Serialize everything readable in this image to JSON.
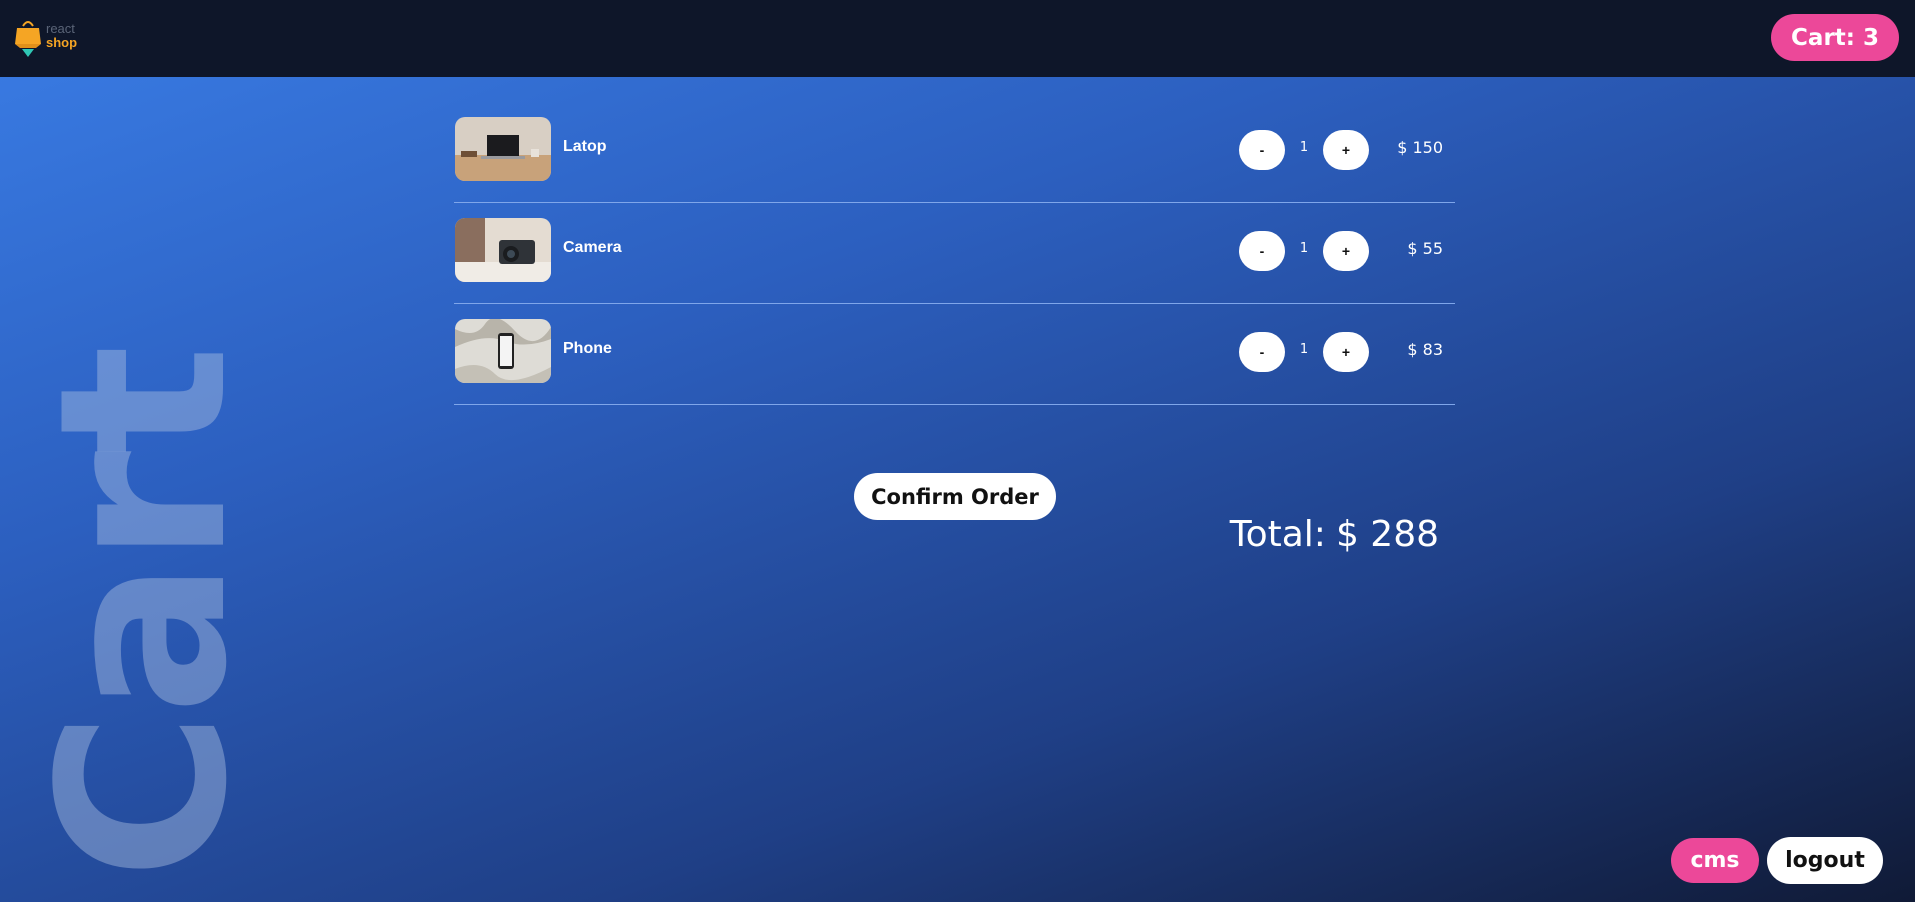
{
  "header": {
    "logo_text_1": "react",
    "logo_text_2": "shop",
    "cart_label": "Cart:",
    "cart_count": "3"
  },
  "page": {
    "background_word": "Cart"
  },
  "cart": {
    "items": [
      {
        "name": "Latop",
        "quantity": "1",
        "price": "$ 150",
        "minus_label": "-",
        "plus_label": "+",
        "image": "laptop-image"
      },
      {
        "name": "Camera",
        "quantity": "1",
        "price": "$ 55",
        "minus_label": "-",
        "plus_label": "+",
        "image": "camera-image"
      },
      {
        "name": "Phone",
        "quantity": "1",
        "price": "$ 83",
        "minus_label": "-",
        "plus_label": "+",
        "image": "phone-image"
      }
    ],
    "total_label": "Total:",
    "total_value": "$ 288",
    "confirm_label": "Confirm Order"
  },
  "footer": {
    "cms_label": "cms",
    "logout_label": "logout"
  },
  "colors": {
    "accent": "#ec4899",
    "topbar": "#0e1629",
    "divider": "#7fa6ea"
  }
}
